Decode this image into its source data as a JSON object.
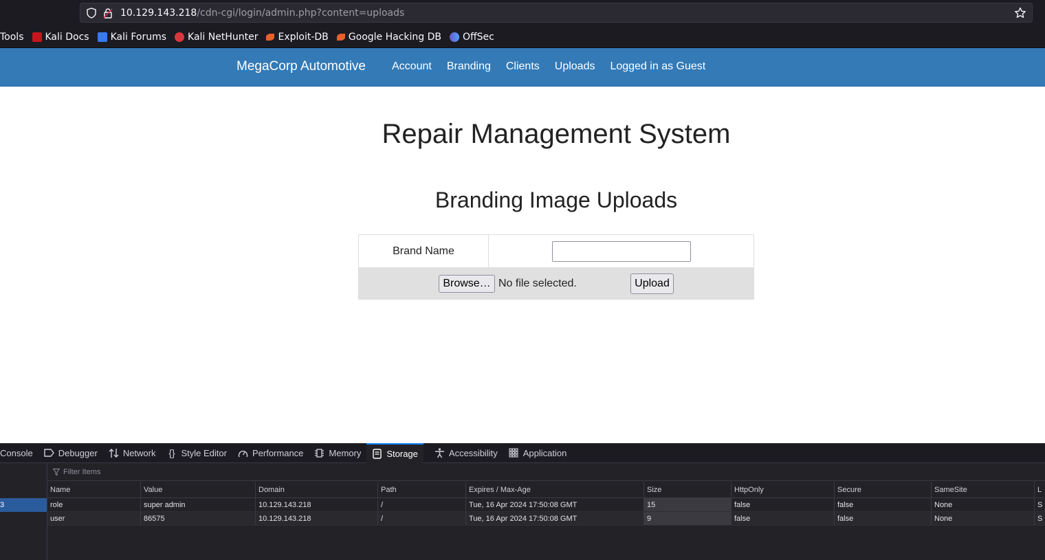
{
  "browser": {
    "url_host": "10.129.143.218",
    "url_path": "/cdn-cgi/login/admin.php?content=uploads",
    "bookmarks": [
      "Tools",
      "Kali Docs",
      "Kali Forums",
      "Kali NetHunter",
      "Exploit-DB",
      "Google Hacking DB",
      "OffSec"
    ]
  },
  "navbar": {
    "brand": "MegaCorp Automotive",
    "links": [
      "Account",
      "Branding",
      "Clients",
      "Uploads",
      "Logged in as Guest"
    ]
  },
  "page": {
    "title": "Repair Management System",
    "subtitle": "Branding Image Uploads",
    "form": {
      "brand_label": "Brand Name",
      "brand_value": "",
      "browse_label": "Browse…",
      "no_file_text": "No file selected.",
      "upload_label": "Upload"
    }
  },
  "devtools": {
    "tabs": [
      "Console",
      "Debugger",
      "Network",
      "Style Editor",
      "Performance",
      "Memory",
      "Storage",
      "Accessibility",
      "Application"
    ],
    "active_tab": "Storage",
    "left_selected": "3",
    "filter_placeholder": "Filter Items",
    "columns": [
      "Name",
      "Value",
      "Domain",
      "Path",
      "Expires / Max-Age",
      "Size",
      "HttpOnly",
      "Secure",
      "SameSite",
      "L"
    ],
    "rows": [
      [
        "role",
        "super admin",
        "10.129.143.218",
        "/",
        "Tue, 16 Apr 2024 17:50:08 GMT",
        "15",
        "false",
        "false",
        "None",
        "S"
      ],
      [
        "user",
        "86575",
        "10.129.143.218",
        "/",
        "Tue, 16 Apr 2024 17:50:08 GMT",
        "9",
        "false",
        "false",
        "None",
        "S"
      ]
    ]
  },
  "colors": {
    "navbar": "#337ab7",
    "devtools_bg": "#232327",
    "accent": "#0a84ff"
  }
}
